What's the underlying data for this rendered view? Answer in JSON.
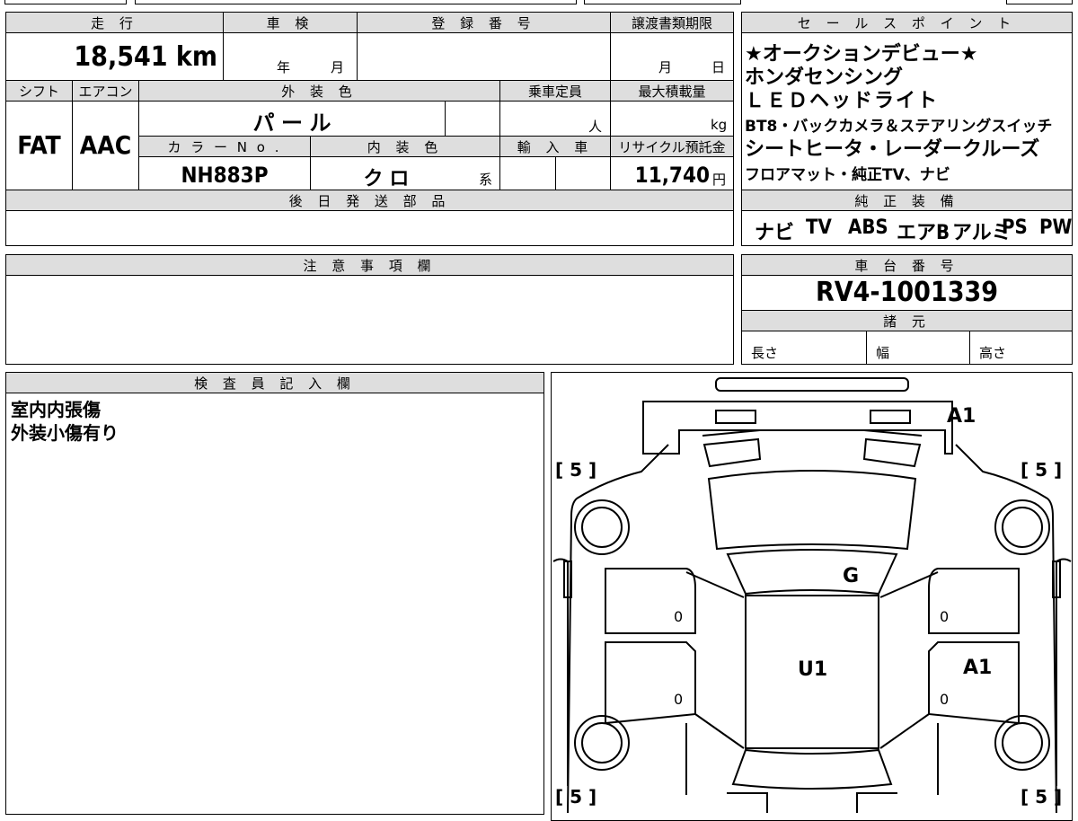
{
  "top": {
    "mileage_label": "走 行",
    "mileage_value": "18,541 km",
    "inspection_label": "車 検",
    "inspection_year": "年",
    "inspection_month": "月",
    "registration_label": "登 録 番 号",
    "transfer_label": "譲渡書類期限",
    "transfer_month": "月",
    "transfer_day": "日",
    "shift_label": "シフト",
    "shift_value": "FAT",
    "ac_label": "エアコン",
    "ac_value": "AAC",
    "exterior_label": "外 装 色",
    "exterior_value": "パ ー ル",
    "capacity_label": "乗車定員",
    "capacity_unit": "人",
    "maxload_label": "最大積載量",
    "maxload_unit": "kg",
    "colorno_label": "カ ラ ー N o .",
    "colorno_value": "NH883P",
    "interior_label": "内 装 色",
    "interior_value": "ク ロ",
    "interior_suffix": "系",
    "import_label": "輸 入 車",
    "recycle_label": "リサイクル預託金",
    "recycle_value": "11,740",
    "recycle_unit": "円",
    "later_parts_label": "後 日 発 送 部 品"
  },
  "sales": {
    "label": "セ ー ル ス ポ イ ン ト",
    "lines": [
      "★オークションデビュー★",
      "ホンダセンシング",
      "ＬＥＤヘッドライト",
      "BT8・バックカメラ＆ステアリングスイッチ",
      "シートヒータ・レーダークルーズ",
      "フロアマット・純正TV、ナビ"
    ]
  },
  "equipment": {
    "label": "純 正 装 備",
    "items": [
      "ナビ",
      "TV",
      "ABS",
      "エアB",
      "アルミ",
      "PS",
      "PW"
    ]
  },
  "notes": {
    "label": "注 意 事 項 欄"
  },
  "chassis": {
    "label": "車 台 番 号",
    "value": "RV4-1001339",
    "specs_label": "諸 元",
    "length": "長さ",
    "width": "幅",
    "height": "高さ"
  },
  "inspector": {
    "label": "検 査 員 記 入 欄",
    "lines": [
      "室内内張傷",
      "外装小傷有り"
    ]
  },
  "diagram": {
    "mark_a1_front": "A1",
    "mark_g": "G",
    "mark_u1": "U1",
    "mark_a1_side": "A1",
    "zero_1": "0",
    "zero_2": "0",
    "zero_3": "0",
    "zero_4": "0",
    "tire_fl": "[ 5 ]",
    "tire_fr": "[ 5 ]",
    "tire_rl": "[ 5 ]",
    "tire_rr": "[ 5 ]"
  }
}
